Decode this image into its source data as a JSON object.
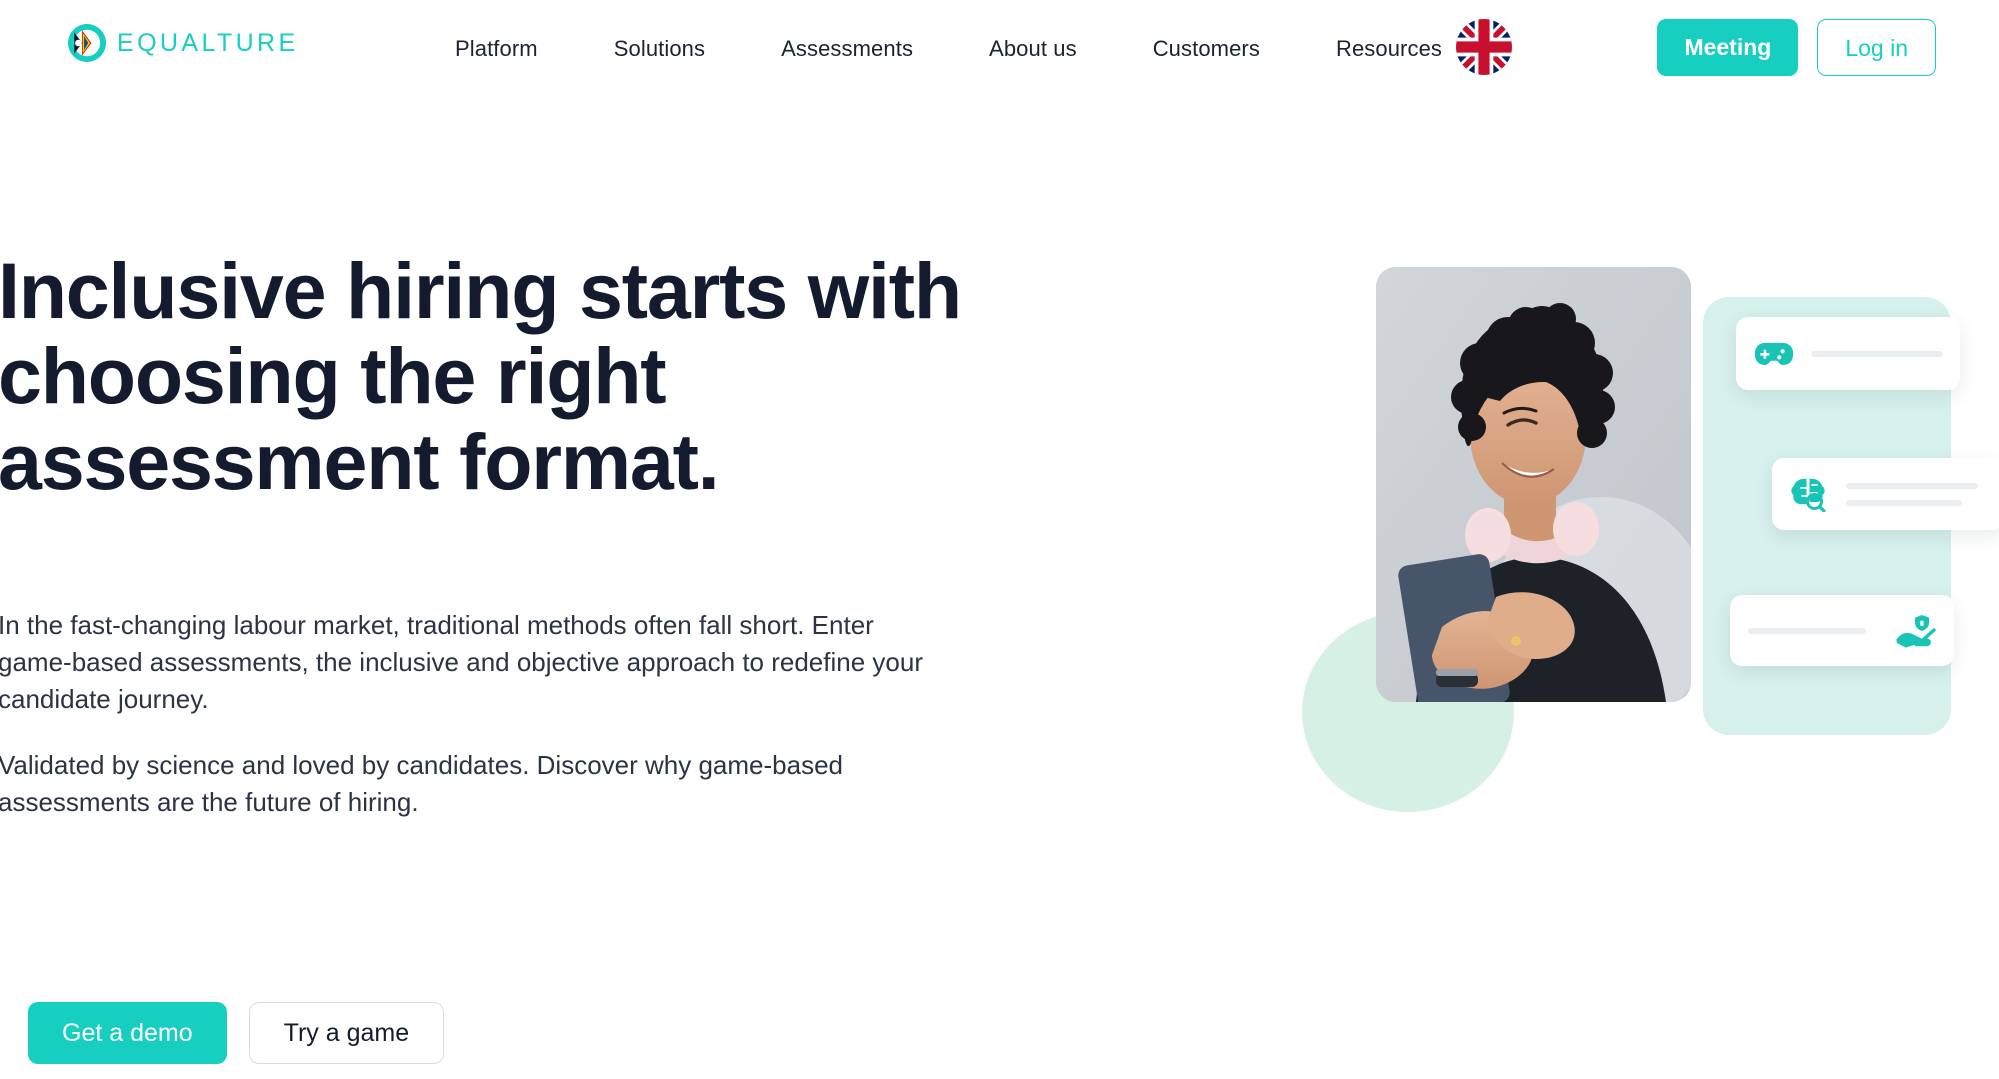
{
  "brand": {
    "name": "EQUALTURE",
    "logo_icon": "pride-circle-icon",
    "accent_color": "#16CFC0",
    "heading_color": "#141B2E",
    "mint_panel_color": "#D6F0EC",
    "mint_blob_color": "#D7F0E5"
  },
  "header": {
    "nav": [
      {
        "label": "Platform"
      },
      {
        "label": "Solutions"
      },
      {
        "label": "Assessments"
      },
      {
        "label": "About us"
      },
      {
        "label": "Customers"
      },
      {
        "label": "Resources"
      }
    ],
    "language_icon": "uk-flag-icon",
    "meeting_label": "Meeting",
    "login_label": "Log in"
  },
  "hero": {
    "title": "Inclusive hiring starts with choosing the right assessment format.",
    "paragraph_1": "In the fast-changing labour market, traditional methods often fall short. Enter game-based assessments, the inclusive and objective approach to redefine your candidate journey.",
    "paragraph_2": "Validated by science and loved by candidates. Discover why game-based assessments are the future of hiring.",
    "cta_primary": "Get a demo",
    "cta_secondary": "Try a game"
  },
  "hero_visual": {
    "photo_alt": "smiling-woman-with-headphones-using-phone",
    "cards": [
      {
        "icon": "gamepad-icon",
        "icon_side": "left",
        "lines": 1
      },
      {
        "icon": "brain-search-icon",
        "icon_side": "left",
        "lines": 2
      },
      {
        "icon": "hand-holding-shield-icon",
        "icon_side": "right",
        "lines": 1
      }
    ]
  }
}
